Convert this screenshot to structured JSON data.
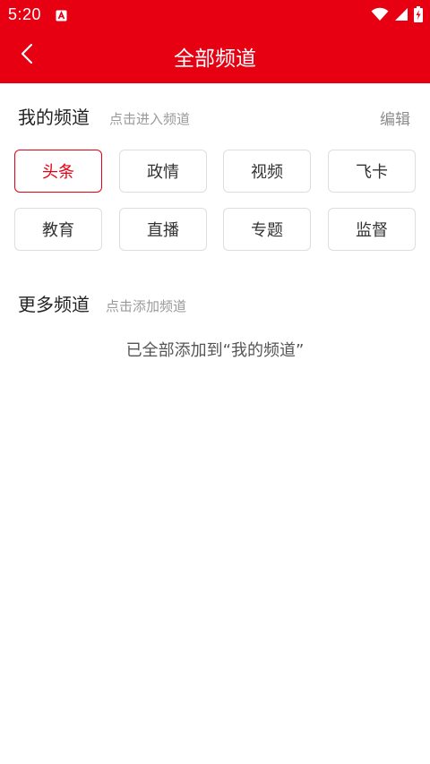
{
  "status_bar": {
    "time": "5:20",
    "icons": [
      "app-notification-icon",
      "wifi-icon",
      "signal-icon",
      "battery-charging-icon"
    ]
  },
  "header": {
    "title": "全部频道",
    "back_icon": "back-arrow-icon",
    "background": "#e60012"
  },
  "my_channels": {
    "title": "我的频道",
    "hint": "点击进入频道",
    "edit_label": "编辑",
    "items": [
      {
        "label": "头条",
        "active": true
      },
      {
        "label": "政情",
        "active": false
      },
      {
        "label": "视频",
        "active": false
      },
      {
        "label": "飞卡",
        "active": false
      },
      {
        "label": "教育",
        "active": false
      },
      {
        "label": "直播",
        "active": false
      },
      {
        "label": "专题",
        "active": false
      },
      {
        "label": "监督",
        "active": false
      }
    ]
  },
  "more_channels": {
    "title": "更多频道",
    "hint": "点击添加频道",
    "empty_text": "已全部添加到“我的频道”"
  },
  "colors": {
    "accent": "#e60012",
    "chip_border": "#dedede",
    "hint_text": "#9a9a9a"
  }
}
